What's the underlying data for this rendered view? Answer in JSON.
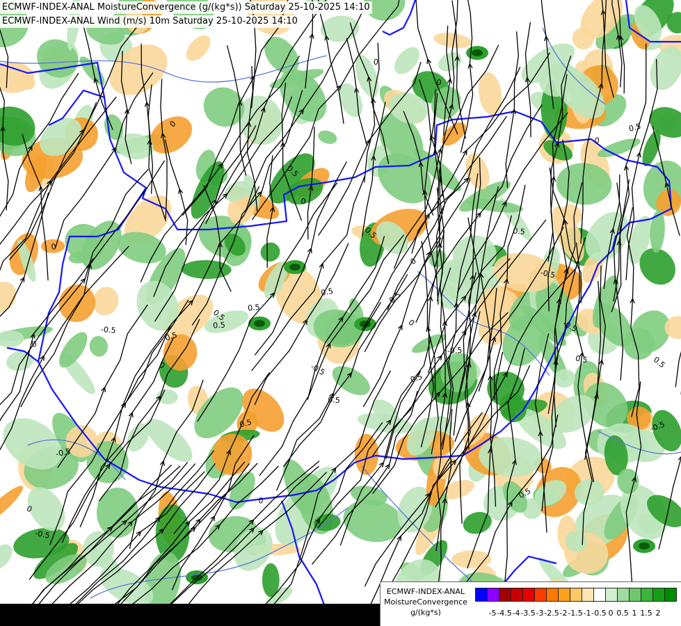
{
  "header": {
    "line1": "ECMWF-INDEX-ANAL MoistureConvergence (g/(kg*s)) Saturday 25-10-2025 14:10",
    "line2": "ECMWF-INDEX-ANAL Wind (m/s) 10m Saturday 25-10-2025 14:10"
  },
  "legend": {
    "model": "ECMWF-INDEX-ANAL",
    "parameter": "MoistureConvergence",
    "unit": "g/(kg*s)",
    "swatch_colors": [
      "#0000ff",
      "#8c00ff",
      "#a00000",
      "#c80000",
      "#e60000",
      "#ff3c00",
      "#ff7800",
      "#ffa01e",
      "#ffc864",
      "#ffe6b4",
      "#ffffff",
      "#d2f0d2",
      "#a0dca0",
      "#6ec86e",
      "#3cb43c",
      "#14a014",
      "#008c00"
    ],
    "tick_labels": [
      "-5",
      "-4.5",
      "-4",
      "-3.5",
      "-3",
      "-2.5",
      "-2",
      "-1.5",
      "-1",
      "-0.5",
      "0",
      "0.5",
      "1",
      "1.5",
      "2"
    ]
  },
  "map": {
    "contour_labels": [
      "0.5",
      "0",
      "-0.5",
      "0.5",
      "0",
      "0.5",
      "-0.5",
      "0",
      "0.5",
      "0.5",
      "0",
      "-0.5",
      "0.5",
      "0",
      "0.5",
      "-0.5",
      "0.5",
      "0",
      "0.5",
      "0",
      "-0.5",
      "0.5",
      "0",
      "0.5",
      "-0.5",
      "0",
      "0.5",
      "0.5",
      "-0.5",
      "0",
      "0.5",
      "0",
      "0.5",
      "-0.5",
      "0.5",
      "0"
    ],
    "palette": {
      "strong_neg": "#f5a030",
      "weak_neg": "#fbd79a",
      "zero": "#ffffff",
      "weak_pos": "#bde6bd",
      "pos": "#7fcc7f",
      "strong_pos": "#2ea02e",
      "peak": "#0a5a0a",
      "border": "#1414ff",
      "river": "#5a78d8",
      "streamline": "#000000"
    }
  }
}
